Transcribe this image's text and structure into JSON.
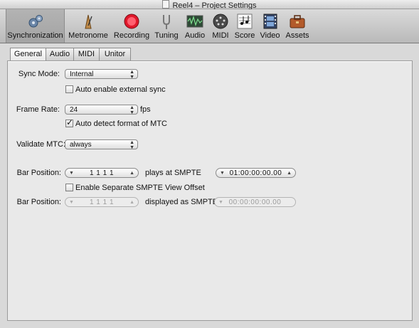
{
  "window": {
    "title": "Reel4 – Project Settings"
  },
  "toolbar": {
    "items": [
      {
        "label": "Synchronization",
        "icon": "gears-icon",
        "selected": true
      },
      {
        "label": "Metronome",
        "icon": "metronome-icon"
      },
      {
        "label": "Recording",
        "icon": "record-icon"
      },
      {
        "label": "Tuning",
        "icon": "tuning-fork-icon"
      },
      {
        "label": "Audio",
        "icon": "audio-waveform-icon"
      },
      {
        "label": "MIDI",
        "icon": "midi-port-icon"
      },
      {
        "label": "Score",
        "icon": "score-notes-icon"
      },
      {
        "label": "Video",
        "icon": "film-strip-icon"
      },
      {
        "label": "Assets",
        "icon": "briefcase-icon"
      }
    ]
  },
  "tabs": [
    {
      "label": "General",
      "active": true
    },
    {
      "label": "Audio"
    },
    {
      "label": "MIDI"
    },
    {
      "label": "Unitor"
    }
  ],
  "general": {
    "sync_mode": {
      "label": "Sync Mode:",
      "value": "Internal"
    },
    "auto_enable_external_sync": {
      "label": "Auto enable external sync",
      "checked": false
    },
    "frame_rate": {
      "label": "Frame Rate:",
      "value": "24",
      "unit": "fps"
    },
    "auto_detect_mtc": {
      "label": "Auto detect format of MTC",
      "checked": true
    },
    "validate_mtc": {
      "label": "Validate MTC:",
      "value": "always"
    },
    "bar_position_1": {
      "label": "Bar Position:",
      "value": "1  1  1     1",
      "mid_label": "plays at SMPTE",
      "smpte": "01:00:00:00.00"
    },
    "separate_smpte": {
      "label": "Enable Separate SMPTE View Offset",
      "checked": false
    },
    "bar_position_2": {
      "label": "Bar Position:",
      "value": "1  1  1     1",
      "mid_label": "displayed as SMPTE",
      "smpte": "00:00:00:00.00"
    }
  },
  "colors": {
    "record": "#e0182b",
    "selected_toolbar": "#a8a8a8"
  }
}
